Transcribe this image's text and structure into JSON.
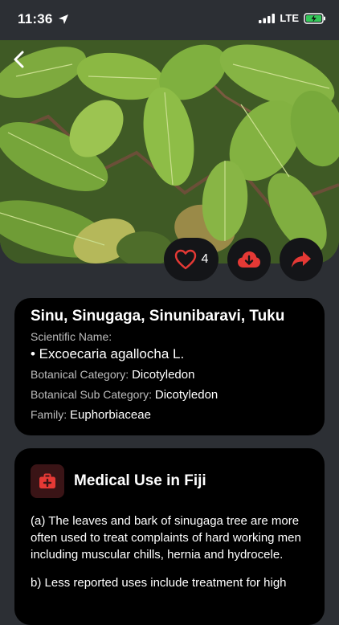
{
  "status_bar": {
    "time": "11:36",
    "network": "LTE",
    "icons": [
      "location-arrow-icon",
      "signal-icon",
      "battery-charging-icon"
    ]
  },
  "colors": {
    "background": "#2c2f34",
    "card": "#000000",
    "accent_red": "#e53935",
    "muted_label": "#bdbdbd"
  },
  "actions": {
    "like_count": "4",
    "icons": [
      "heart-outline-icon",
      "cloud-download-icon",
      "share-arrow-icon"
    ]
  },
  "plant": {
    "common_names": "Sinu, Sinugaga, Sinunibaravi, Tuku",
    "scientific_label": "Scientific Name:",
    "scientific_name": "• Excoecaria agallocha L.",
    "category_label": "Botanical Category:",
    "category_value": "Dicotyledon",
    "sub_category_label": "Botanical Sub Category:",
    "sub_category_value": "Dicotyledon",
    "family_label": "Family:",
    "family_value": "Euphorbiaceae"
  },
  "medical": {
    "title": "Medical Use in Fiji",
    "icon": "first-aid-kit-icon",
    "paragraphs": [
      "(a) The leaves and bark of sinugaga tree are more often used to treat complaints of hard working men including muscular chills, hernia and hydrocele.",
      "b) Less reported uses include treatment for high"
    ]
  }
}
